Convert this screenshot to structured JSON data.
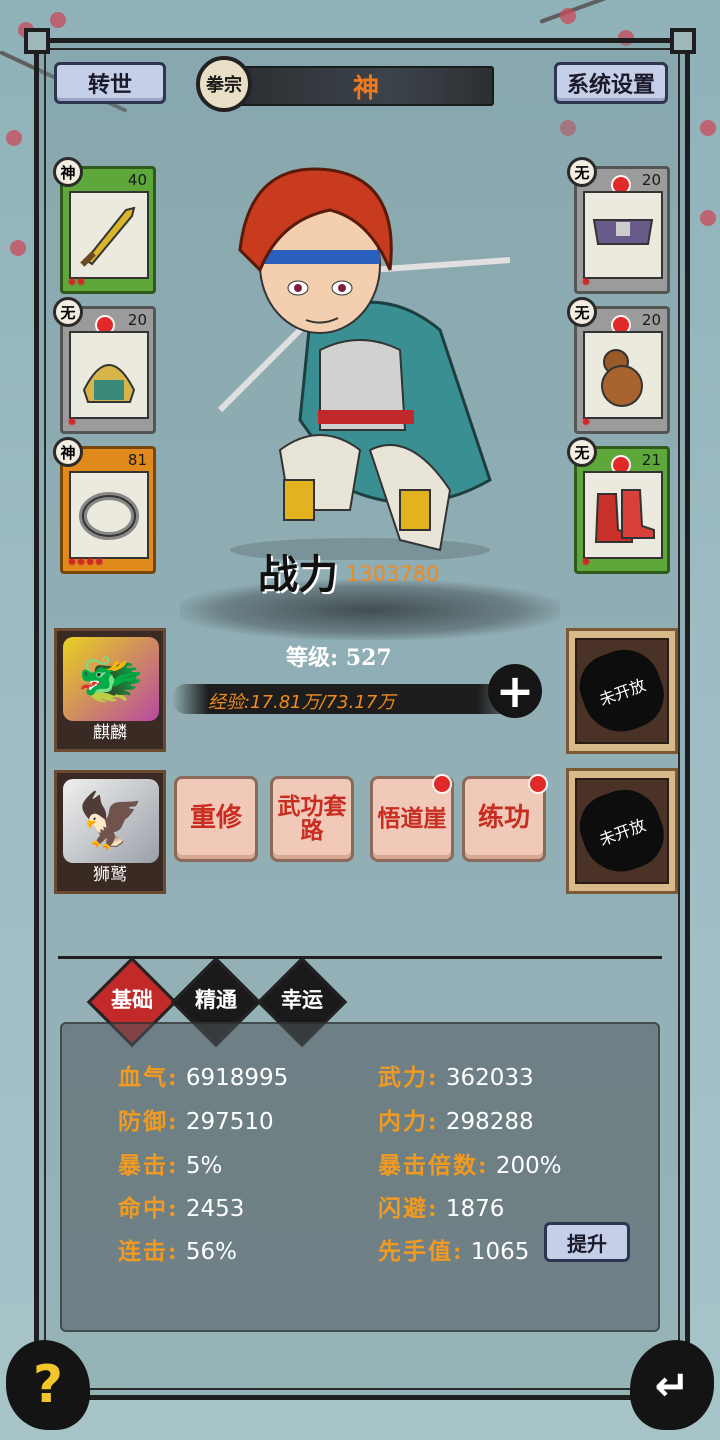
{
  "header": {
    "rebirth_label": "转世",
    "sect_label": "拳宗",
    "title": "神",
    "settings_label": "系统设置"
  },
  "equipment": {
    "left": [
      {
        "grade": "神",
        "level": "40",
        "item_icon": "sword-icon",
        "stars": "✹✹"
      },
      {
        "grade": "无",
        "level": "20",
        "item_icon": "helmet-icon",
        "stars": "✹"
      },
      {
        "grade": "神",
        "level": "81",
        "item_icon": "ring-icon",
        "stars": "✹✹✹✹"
      }
    ],
    "right": [
      {
        "grade": "无",
        "level": "20",
        "item_icon": "belt-icon",
        "stars": "✹"
      },
      {
        "grade": "无",
        "level": "20",
        "item_icon": "gourd-icon",
        "stars": "✹"
      },
      {
        "grade": "无",
        "level": "21",
        "item_icon": "boots-icon",
        "stars": "✹"
      }
    ]
  },
  "power": {
    "label": "战力",
    "value": "1303780"
  },
  "level": {
    "text": "等级: 527"
  },
  "exp": {
    "text": "经验:17.81万/73.17万"
  },
  "pets": [
    {
      "name": "麒麟"
    },
    {
      "name": "狮鹫"
    }
  ],
  "locked_slots": [
    {
      "label": "未开放"
    },
    {
      "label": "未开放"
    }
  ],
  "actions": [
    {
      "label": "重修"
    },
    {
      "label": "武功套路"
    },
    {
      "label": "悟道崖"
    },
    {
      "label": "练功"
    }
  ],
  "tabs": [
    {
      "label": "基础"
    },
    {
      "label": "精通"
    },
    {
      "label": "幸运"
    }
  ],
  "stats": {
    "hp": {
      "key": "血气:",
      "value": "6918995"
    },
    "defense": {
      "key": "防御:",
      "value": "297510"
    },
    "crit": {
      "key": "暴击:",
      "value": "5%"
    },
    "hit": {
      "key": "命中:",
      "value": "2453"
    },
    "combo": {
      "key": "连击:",
      "value": "56%"
    },
    "force": {
      "key": "武力:",
      "value": "362033"
    },
    "inner": {
      "key": "内力:",
      "value": "298288"
    },
    "crit_mult": {
      "key": "暴击倍数:",
      "value": "200%"
    },
    "dodge": {
      "key": "闪避:",
      "value": "1876"
    },
    "initiative": {
      "key": "先手值:",
      "value": "1065"
    }
  },
  "upgrade_label": "提升",
  "help_icon": "?",
  "back_icon": "↵"
}
